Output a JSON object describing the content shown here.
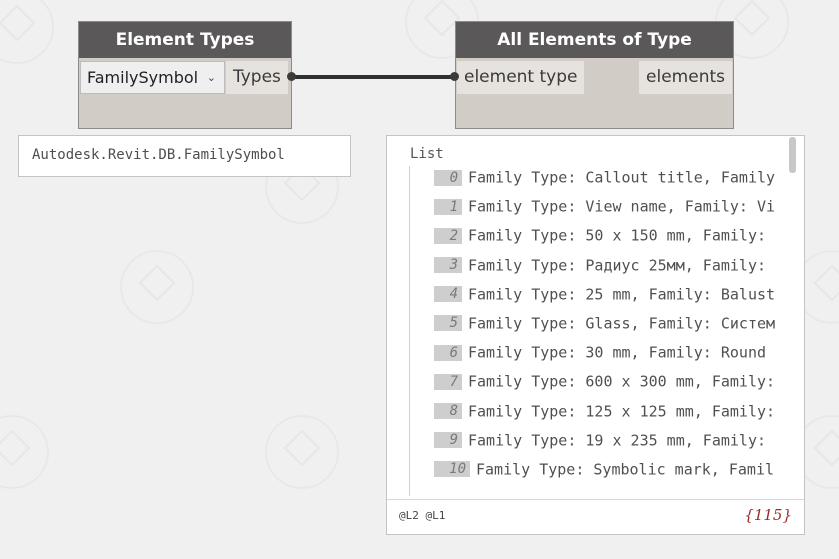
{
  "nodes": {
    "element_types": {
      "title": "Element Types",
      "dropdown_value": "FamilySymbol",
      "dropdown_icon": "chevron-down-icon",
      "output_port": "Types",
      "preview": "Autodesk.Revit.DB.FamilySymbol"
    },
    "all_elements": {
      "title": "All Elements of Type",
      "input_port": "element type",
      "output_port": "elements"
    }
  },
  "preview": {
    "list_title": "List",
    "items": [
      {
        "index": "0",
        "text": "Family Type: Callout title, Family"
      },
      {
        "index": "1",
        "text": "Family Type: View name, Family: Vi"
      },
      {
        "index": "2",
        "text": "Family Type: 50 x 150 mm, Family:"
      },
      {
        "index": "3",
        "text": "Family Type: Радиус 25мм, Family:"
      },
      {
        "index": "4",
        "text": "Family Type: 25 mm, Family: Balust"
      },
      {
        "index": "5",
        "text": "Family Type: Glass, Family: Систем"
      },
      {
        "index": "6",
        "text": "Family Type: 30 mm, Family: Round"
      },
      {
        "index": "7",
        "text": "Family Type: 600 x 300 mm, Family:"
      },
      {
        "index": "8",
        "text": "Family Type: 125 x 125 mm, Family:"
      },
      {
        "index": "9",
        "text": "Family Type: 19 x 235 mm, Family:"
      },
      {
        "index": "10",
        "text": "Family Type: Symbolic mark, Famil"
      }
    ],
    "levels": "@L2 @L1",
    "count": "{115}"
  },
  "colors": {
    "node_header": "#5a5858",
    "node_body": "#d1cdc6",
    "canvas": "#f0f0f0",
    "count_text": "#9a2a2a"
  }
}
